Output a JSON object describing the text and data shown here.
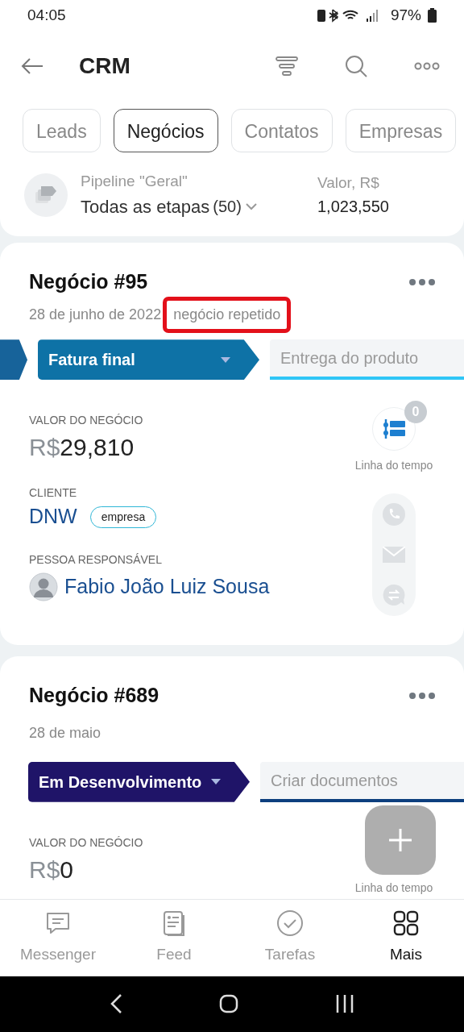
{
  "status_bar": {
    "time": "04:05",
    "battery": "97%"
  },
  "header": {
    "title": "CRM"
  },
  "tabs": [
    {
      "label": "Leads",
      "selected": false
    },
    {
      "label": "Negócios",
      "selected": true
    },
    {
      "label": "Contatos",
      "selected": false
    },
    {
      "label": "Empresas",
      "selected": false
    }
  ],
  "pipeline": {
    "label": "Pipeline \"Geral\"",
    "stage": "Todas as etapas",
    "count": "(50)",
    "value_label": "Valor, R$",
    "value": "1,023,550"
  },
  "deals": [
    {
      "title": "Negócio #95",
      "date": "28 de junho de 2022",
      "tag": {
        "text": "negócio repetido",
        "highlighted": true
      },
      "stages": [
        {
          "kind": "passed",
          "color": "#17639a"
        },
        {
          "kind": "current",
          "label": "Fatura final",
          "color": "#0e72a6"
        },
        {
          "kind": "next",
          "label": "Entrega do produto",
          "color": "#2fc6f6"
        }
      ],
      "value_label": "VALOR DO NEGÓCIO",
      "currency": "R$",
      "amount": "29,810",
      "client": {
        "label": "CLIENTE",
        "name": "DNW",
        "type": "empresa"
      },
      "responsible": {
        "label": "PESSOA RESPONSÁVEL",
        "name": "Fabio João Luiz Sousa"
      },
      "timeline": {
        "label": "Linha do tempo",
        "count": "0"
      },
      "contact_actions": true
    },
    {
      "title": "Negócio #689",
      "date": "28 de maio",
      "stages": [
        {
          "kind": "current",
          "label": "Em Desenvolvimento",
          "color": "#1f1468"
        },
        {
          "kind": "next",
          "label": "Criar documentos",
          "color": "#0d3f7e"
        }
      ],
      "value_label": "VALOR DO NEGÓCIO",
      "currency": "R$",
      "amount": "0",
      "timeline": {
        "label": "Linha do tempo"
      }
    }
  ],
  "bottom_nav": [
    {
      "kind": "messenger",
      "label": "Messenger",
      "selected": false
    },
    {
      "kind": "feed",
      "label": "Feed",
      "selected": false
    },
    {
      "kind": "tasks",
      "label": "Tarefas",
      "selected": false
    },
    {
      "kind": "more",
      "label": "Mais",
      "selected": true
    }
  ]
}
